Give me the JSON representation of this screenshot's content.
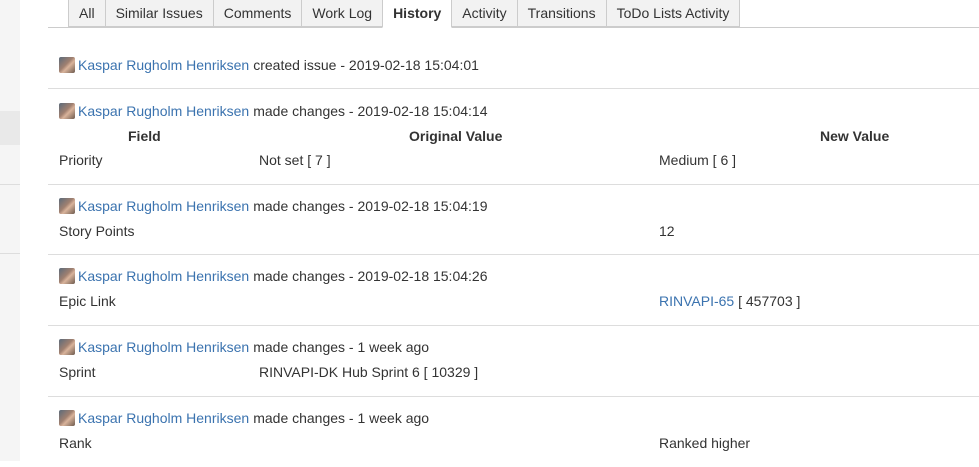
{
  "tabs": [
    "All",
    "Similar Issues",
    "Comments",
    "Work Log",
    "History",
    "Activity",
    "Transitions",
    "ToDo Lists Activity"
  ],
  "active_tab": "History",
  "table_headers": {
    "field": "Field",
    "original": "Original Value",
    "new": "New Value"
  },
  "entries": [
    {
      "user": "Kaspar Rugholm Henriksen",
      "action": "created issue - 2019-02-18 15:04:01"
    },
    {
      "user": "Kaspar Rugholm Henriksen",
      "action": "made changes - 2019-02-18 15:04:14",
      "field": "Priority",
      "original": "Not set [ 7 ]",
      "new": "Medium [ 6 ]"
    },
    {
      "user": "Kaspar Rugholm Henriksen",
      "action": "made changes - 2019-02-18 15:04:19",
      "field": "Story Points",
      "original": "",
      "new": "12"
    },
    {
      "user": "Kaspar Rugholm Henriksen",
      "action": "made changes - 2019-02-18 15:04:26",
      "field": "Epic Link",
      "original": "",
      "new_link": "RINVAPI-65",
      "new_suffix": "[ 457703 ]"
    },
    {
      "user": "Kaspar Rugholm Henriksen",
      "action": "made changes - 1 week ago",
      "field": "Sprint",
      "original": "RINVAPI-DK Hub Sprint 6 [ 10329 ]",
      "new": ""
    },
    {
      "user": "Kaspar Rugholm Henriksen",
      "action": "made changes - 1 week ago",
      "field": "Rank",
      "original": "",
      "new": "Ranked higher"
    }
  ]
}
